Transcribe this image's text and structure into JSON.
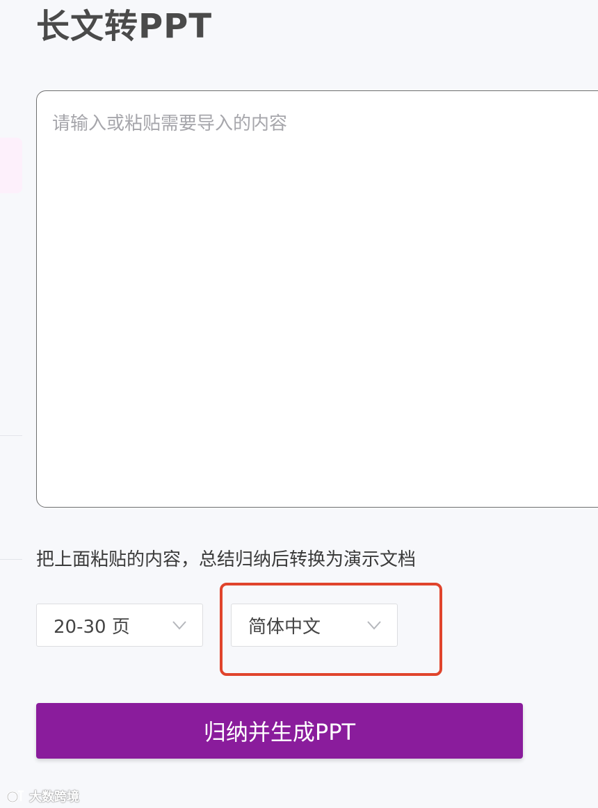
{
  "header": {
    "title": "长文转PPT"
  },
  "editor": {
    "placeholder": "请输入或粘贴需要导入的内容",
    "value": ""
  },
  "description": "把上面粘贴的内容，总结归纳后转换为演示文档",
  "options": {
    "page_range": {
      "selected": "20-30 页"
    },
    "language": {
      "selected": "简体中文"
    }
  },
  "actions": {
    "generate_label": "归纳并生成PPT"
  },
  "watermark": {
    "text": "大数跨境"
  },
  "colors": {
    "primary": "#8a1c9c",
    "highlight": "#e0442c",
    "background": "#f7f8fb",
    "sidebar_highlight": "#fdf0fb"
  },
  "icons": {
    "dropdown": "chevron-down-icon",
    "watermark": "logo-icon"
  }
}
